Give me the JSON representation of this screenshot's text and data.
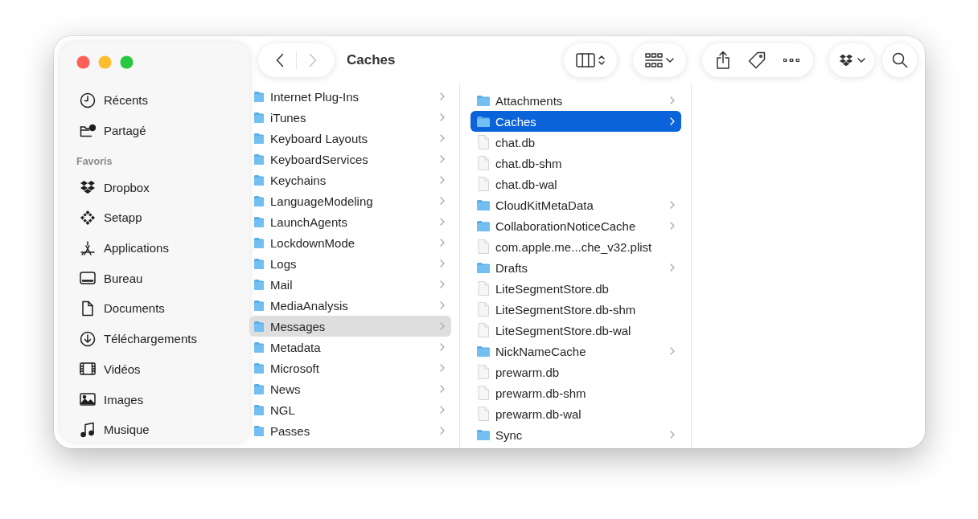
{
  "window": {
    "title": "Caches"
  },
  "navigation": {
    "back_disabled": false,
    "forward_disabled": true
  },
  "sidebar": {
    "sections": [
      {
        "items": [
          {
            "label": "Récents",
            "selected": false
          },
          {
            "label": "Partagé",
            "selected": false
          }
        ]
      },
      {
        "header": "Favoris",
        "items": [
          {
            "label": "Dropbox",
            "selected": false
          },
          {
            "label": "Setapp",
            "selected": false
          },
          {
            "label": "Applications",
            "selected": false
          },
          {
            "label": "Bureau",
            "selected": false
          },
          {
            "label": "Documents",
            "selected": false
          },
          {
            "label": "Téléchargements",
            "selected": false
          },
          {
            "label": "Vidéos",
            "selected": false
          },
          {
            "label": "Images",
            "selected": false
          },
          {
            "label": "Musique",
            "selected": false
          }
        ]
      }
    ]
  },
  "columns": [
    {
      "focused": false,
      "items": [
        {
          "name": "Internet Plug-Ins",
          "kind": "folder",
          "selected": false
        },
        {
          "name": "iTunes",
          "kind": "folder",
          "selected": false
        },
        {
          "name": "Keyboard Layouts",
          "kind": "folder",
          "selected": false
        },
        {
          "name": "KeyboardServices",
          "kind": "folder",
          "selected": false
        },
        {
          "name": "Keychains",
          "kind": "folder",
          "selected": false
        },
        {
          "name": "LanguageModeling",
          "kind": "folder",
          "selected": false
        },
        {
          "name": "LaunchAgents",
          "kind": "folder",
          "selected": false
        },
        {
          "name": "LockdownMode",
          "kind": "folder",
          "selected": false
        },
        {
          "name": "Logs",
          "kind": "folder",
          "selected": false
        },
        {
          "name": "Mail",
          "kind": "folder",
          "selected": false
        },
        {
          "name": "MediaAnalysis",
          "kind": "folder",
          "selected": false
        },
        {
          "name": "Messages",
          "kind": "folder",
          "selected": true
        },
        {
          "name": "Metadata",
          "kind": "folder",
          "selected": false
        },
        {
          "name": "Microsoft",
          "kind": "folder",
          "selected": false
        },
        {
          "name": "News",
          "kind": "folder",
          "selected": false
        },
        {
          "name": "NGL",
          "kind": "folder",
          "selected": false
        },
        {
          "name": "Passes",
          "kind": "folder",
          "selected": false
        }
      ]
    },
    {
      "focused": true,
      "items": [
        {
          "name": "Attachments",
          "kind": "folder",
          "selected": false
        },
        {
          "name": "Caches",
          "kind": "folder",
          "selected": true
        },
        {
          "name": "chat.db",
          "kind": "file",
          "selected": false
        },
        {
          "name": "chat.db-shm",
          "kind": "file",
          "selected": false
        },
        {
          "name": "chat.db-wal",
          "kind": "file",
          "selected": false
        },
        {
          "name": "CloudKitMetaData",
          "kind": "folder",
          "selected": false
        },
        {
          "name": "CollaborationNoticeCache",
          "kind": "folder",
          "selected": false
        },
        {
          "name": "com.apple.me...che_v32.plist",
          "kind": "file",
          "selected": false
        },
        {
          "name": "Drafts",
          "kind": "folder",
          "selected": false
        },
        {
          "name": "LiteSegmentStore.db",
          "kind": "file",
          "selected": false
        },
        {
          "name": "LiteSegmentStore.db-shm",
          "kind": "file",
          "selected": false
        },
        {
          "name": "LiteSegmentStore.db-wal",
          "kind": "file",
          "selected": false
        },
        {
          "name": "NickNameCache",
          "kind": "folder",
          "selected": false
        },
        {
          "name": "prewarm.db",
          "kind": "file",
          "selected": false
        },
        {
          "name": "prewarm.db-shm",
          "kind": "file",
          "selected": false
        },
        {
          "name": "prewarm.db-wal",
          "kind": "file",
          "selected": false
        },
        {
          "name": "Sync",
          "kind": "folder",
          "selected": false
        }
      ]
    }
  ]
}
